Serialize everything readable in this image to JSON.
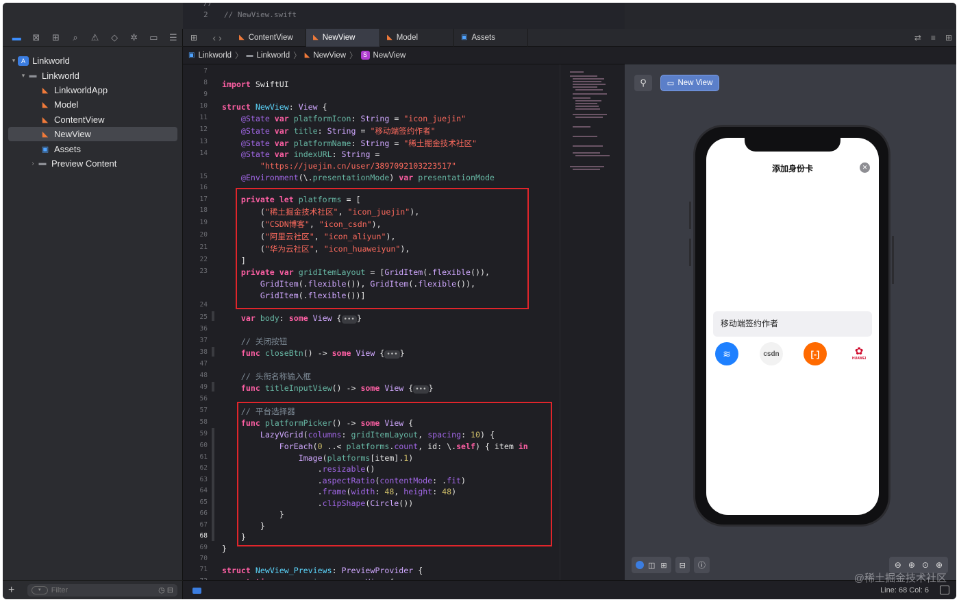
{
  "navigator": {
    "toolbar_icons": [
      "folder-icon",
      "source-control-icon",
      "symbol-icon",
      "find-icon",
      "issue-icon",
      "test-icon",
      "debug-icon",
      "breakpoint-icon",
      "report-icon"
    ],
    "tree": [
      {
        "label": "Linkworld",
        "kind": "project",
        "level": 0,
        "expanded": true
      },
      {
        "label": "Linkworld",
        "kind": "folder",
        "level": 1,
        "expanded": true
      },
      {
        "label": "LinkworldApp",
        "kind": "swift",
        "level": 2
      },
      {
        "label": "Model",
        "kind": "swift",
        "level": 2
      },
      {
        "label": "ContentView",
        "kind": "swift",
        "level": 2
      },
      {
        "label": "NewView",
        "kind": "swift",
        "level": 2,
        "selected": true
      },
      {
        "label": "Assets",
        "kind": "assets",
        "level": 2
      },
      {
        "label": "Preview Content",
        "kind": "folder",
        "level": 1,
        "expanded": false
      }
    ],
    "filter_placeholder": "Filter"
  },
  "ghost": {
    "line2_num": "2",
    "line2_text": "//  NewView.swift"
  },
  "tabs": [
    {
      "label": "ContentView",
      "icon": "swift-icon",
      "active": false
    },
    {
      "label": "NewView",
      "icon": "swift-icon",
      "active": true
    },
    {
      "label": "Model",
      "icon": "swift-icon",
      "active": false
    },
    {
      "label": "Assets",
      "icon": "assets-icon",
      "active": false
    }
  ],
  "breadcrumb": [
    "Linkworld",
    "Linkworld",
    "NewView",
    "NewView"
  ],
  "status": {
    "position": "Line: 68  Col: 6"
  },
  "canvas": {
    "preview_button": "New View",
    "sheet_title": "添加身份卡",
    "title_field_value": "移动端签约作者",
    "platforms": [
      "juejin",
      "CSDN",
      "aliyun",
      "HUAWEI"
    ],
    "csdn_label": "csdn",
    "huawei_label": "HUAWEI"
  },
  "watermark": "@稀土掘金技术社区",
  "colors": {
    "accent": "#3b7de0",
    "highlight_box": "#e0252b",
    "swift": "#f07a3a"
  }
}
